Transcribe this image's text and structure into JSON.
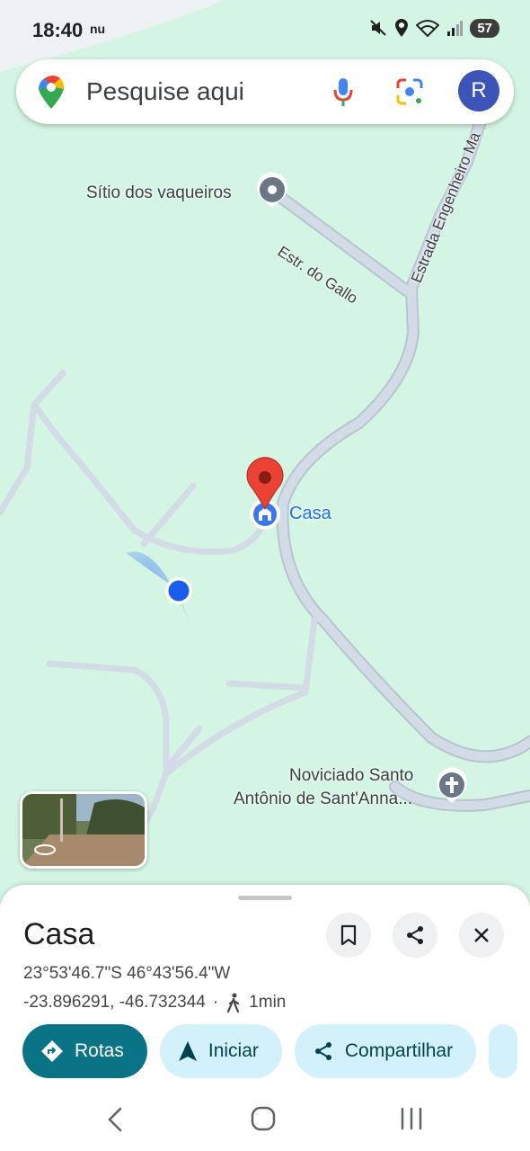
{
  "status_bar": {
    "time": "18:40",
    "carrier": "nu",
    "battery": "57"
  },
  "search": {
    "placeholder": "Pesquise aqui",
    "avatar_letter": "R"
  },
  "map": {
    "labels": {
      "sitio": "Sítio dos vaqueiros",
      "estr_gallo": "Estr. do Gallo",
      "estrada_engenheiro": "Estrada Engenheiro Ma",
      "casa": "Casa",
      "noviciado_line1": "Noviciado Santo",
      "noviciado_line2": "Antônio de Sant'Anna..."
    },
    "colors": {
      "land": "#d4f5e4",
      "road": "#d2dbe6",
      "road_edge": "#b9c4d2",
      "pin": "#ea4335",
      "location_dot": "#1a5cf0"
    }
  },
  "place": {
    "title": "Casa",
    "coords_dms": "23°53'46.7\"S 46°43'56.4\"W",
    "coords_decimal": "-23.896291, -46.732344",
    "separator": "·",
    "walk_time": "1min"
  },
  "actions": {
    "rotas": "Rotas",
    "iniciar": "Iniciar",
    "compartilhar": "Compartilhar"
  },
  "icons": {
    "save": "bookmark-icon",
    "share": "share-icon",
    "close": "close-icon",
    "walk": "walk-icon"
  }
}
